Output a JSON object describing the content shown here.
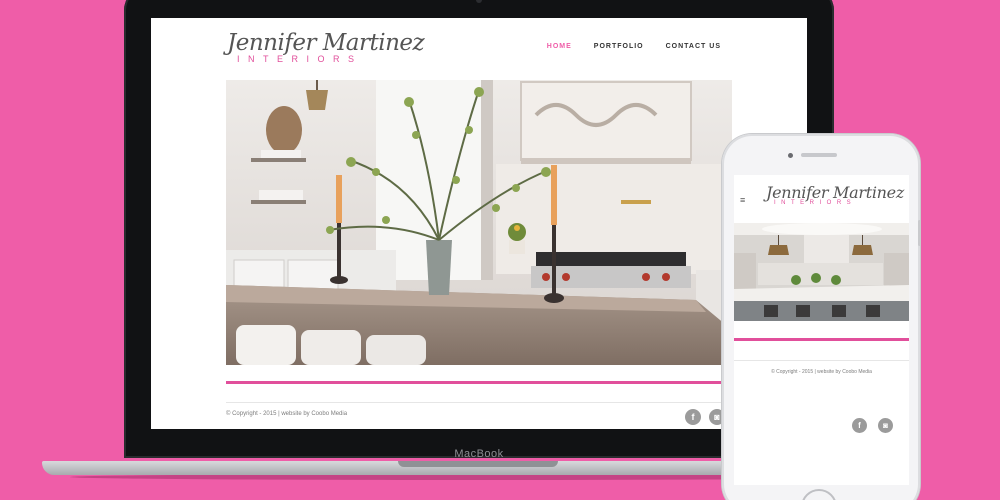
{
  "device_labels": {
    "laptop": "MacBook"
  },
  "brand": {
    "script": "Jennifer Martinez",
    "subtitle": "INTERIORS"
  },
  "nav": [
    {
      "label": "HOME",
      "active": true
    },
    {
      "label": "PORTFOLIO",
      "active": false
    },
    {
      "label": "CONTACT US",
      "active": false
    }
  ],
  "footer": {
    "copyright": "© Copyright - 2015 | website by Coobo Media"
  },
  "social": [
    {
      "icon": "facebook-icon",
      "glyph": "f"
    },
    {
      "icon": "instagram-icon",
      "glyph": "◙"
    }
  ],
  "mobile": {
    "menu_icon": "≡"
  },
  "colors": {
    "background": "#ef5da8",
    "accent": "#e14f9b",
    "nav_active": "#ef5da8"
  }
}
